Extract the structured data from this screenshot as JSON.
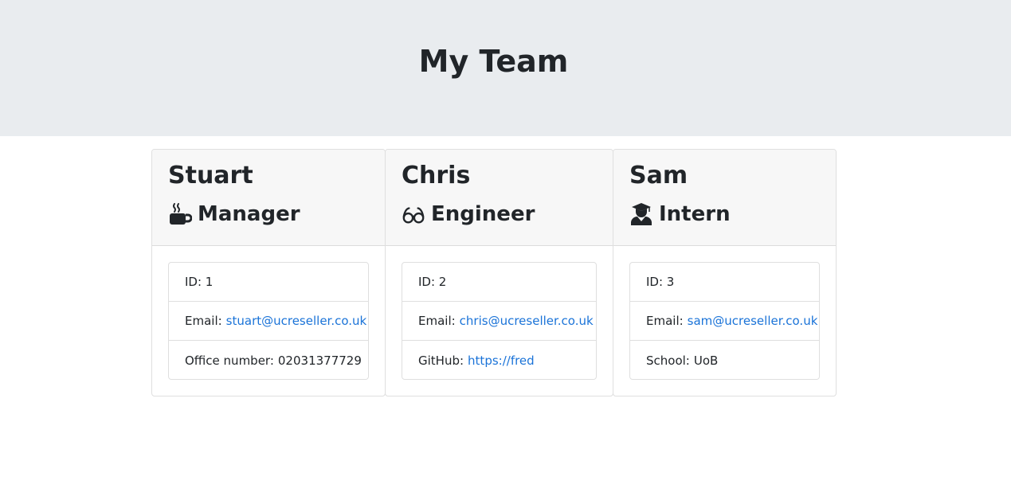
{
  "header": {
    "title": "My Team"
  },
  "employees": [
    {
      "name": "Stuart",
      "role": "Manager",
      "role_icon": "coffee-icon",
      "id_text": "ID: 1",
      "email_label": "Email:",
      "email": "stuart@ucreseller.co.uk",
      "extra_label": "Office number:",
      "extra_value": "02031377729"
    },
    {
      "name": "Chris",
      "role": "Engineer",
      "role_icon": "glasses-icon",
      "id_text": "ID: 2",
      "email_label": "Email:",
      "email": "chris@ucreseller.co.uk",
      "extra_label": "GitHub:",
      "extra_value": "https://fred"
    },
    {
      "name": "Sam",
      "role": "Intern",
      "role_icon": "graduate-icon",
      "id_text": "ID: 3",
      "email_label": "Email:",
      "email": "sam@ucreseller.co.uk",
      "extra_label": "School:",
      "extra_value": "UoB"
    }
  ],
  "colors": {
    "jumbotron_bg": "#e9ecef",
    "card_header_bg": "#f7f7f7",
    "link": "#1a73d8",
    "text": "#212529"
  }
}
